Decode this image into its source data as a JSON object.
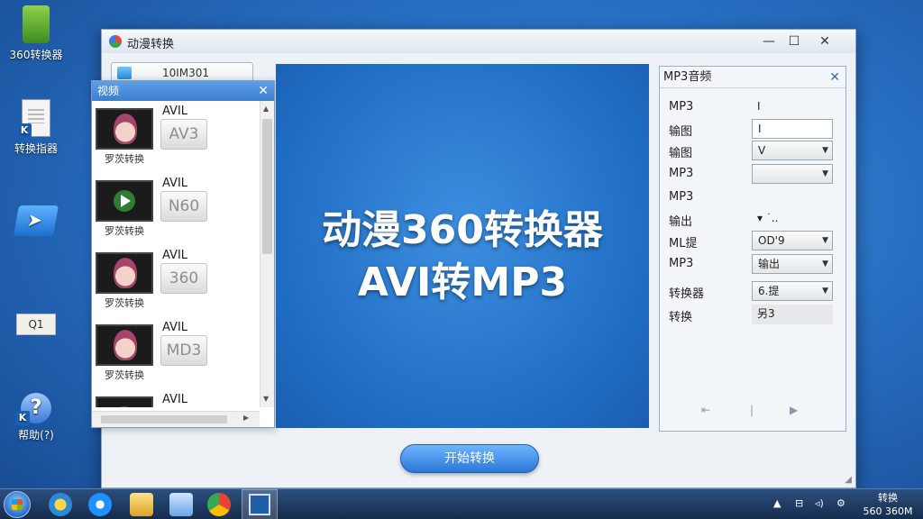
{
  "desktop": {
    "icons": [
      {
        "label": "360转换器",
        "name": "app-360-converter"
      },
      {
        "label": "转换指器",
        "name": "doc-converter-guide"
      },
      {
        "label": "",
        "name": "arrow-shortcut"
      },
      {
        "label": "Q1",
        "name": "small-file"
      },
      {
        "label": "帮助(?)",
        "name": "help-shortcut"
      }
    ]
  },
  "window": {
    "title": "动漫转换",
    "file_field": "10IM301",
    "controls": {
      "minimize": "—",
      "maximize": "☐",
      "close": "✕"
    }
  },
  "list_panel": {
    "title": "视频",
    "close": "✕",
    "items": [
      {
        "format": "AVIL",
        "badge": "AV3",
        "caption": "罗茨转换",
        "thumb": "anime-face"
      },
      {
        "format": "AVIL",
        "badge": "N60",
        "caption": "罗茨转换",
        "thumb": "play"
      },
      {
        "format": "AVIL",
        "badge": "360",
        "caption": "罗茨转换",
        "thumb": "anime-face"
      },
      {
        "format": "AVIL",
        "badge": "MD3",
        "caption": "罗茨转换",
        "thumb": "anime-face"
      },
      {
        "format": "AVIL",
        "badge": "",
        "caption": "",
        "thumb": "play"
      }
    ]
  },
  "preview": {
    "line1": "动漫360转换器",
    "line2": "AVI转MP3"
  },
  "settings": {
    "title": "MP3音频",
    "close": "✕",
    "rows": [
      {
        "label": "MP3",
        "value": "I",
        "type": "plain"
      },
      {
        "label": "输图",
        "value": "I",
        "type": "input"
      },
      {
        "label": "输图",
        "value": "V",
        "type": "select"
      },
      {
        "label": "MP3",
        "value": "",
        "type": "select"
      },
      {
        "label": "MP3",
        "value": "",
        "type": "plain"
      },
      {
        "label": "输出",
        "value": "▾ ˙..",
        "type": "plain"
      },
      {
        "label": "ML提",
        "value": "OD'9",
        "type": "select"
      },
      {
        "label": "MP3",
        "value": "输出",
        "type": "select"
      },
      {
        "label": "转换器",
        "value": "6.提",
        "type": "select"
      },
      {
        "label": "转换",
        "value": "另3",
        "type": "readonly"
      }
    ],
    "nav_prev": "⇤",
    "nav_next": "▶"
  },
  "start_button": "开始转换",
  "taskbar": {
    "tray_icons": [
      "▲",
      "⊟",
      "◃)",
      "⚙"
    ],
    "clock_line1": "转换",
    "clock_line2": "560 360M"
  }
}
